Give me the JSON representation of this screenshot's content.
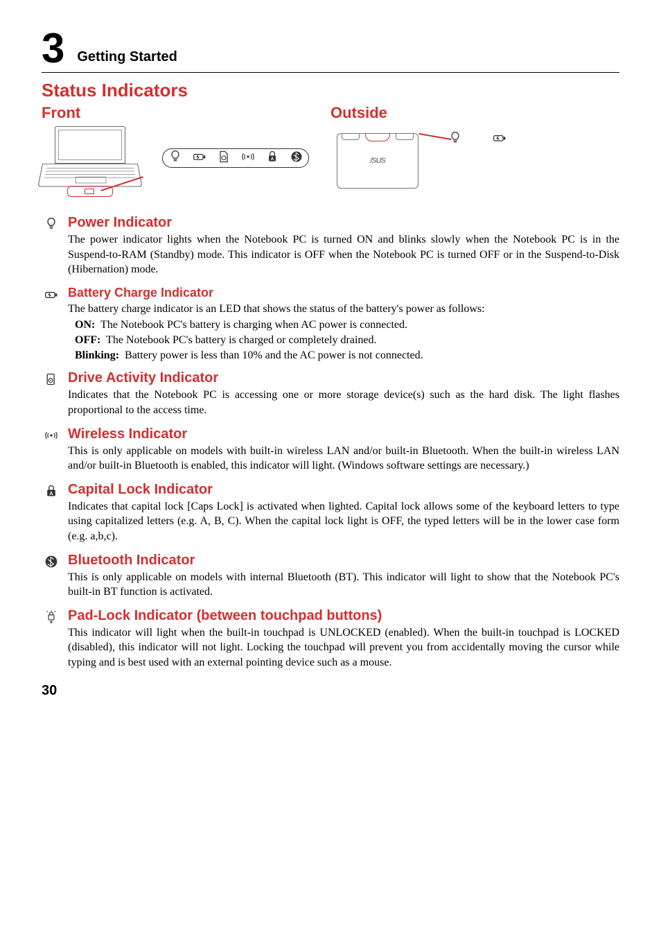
{
  "chapter": {
    "number": "3",
    "title": "Getting Started"
  },
  "section": "Status Indicators",
  "subsections": {
    "front": "Front",
    "outside": "Outside"
  },
  "front_icons": {
    "power": "power-icon",
    "battery": "battery-icon",
    "drive": "drive-icon",
    "wireless": "wireless-icon",
    "caps": "caps-icon",
    "bt": "bt-icon"
  },
  "lid_logo": "/SUS",
  "outside_icons": {
    "power": "power-icon",
    "battery": "battery-icon"
  },
  "indicators": [
    {
      "id": "power",
      "icon": "power-icon",
      "title_size": "big",
      "title": "Power Indicator",
      "body": "The power indicator lights when the Notebook PC is turned ON and blinks slowly when the Notebook PC is in the Suspend-to-RAM (Standby) mode. This indicator is OFF when the Notebook PC is turned OFF or in the Suspend-to-Disk (Hibernation) mode."
    },
    {
      "id": "battery",
      "icon": "battery-icon",
      "title_size": "mid",
      "title": "Battery Charge Indicator",
      "body": "The battery charge indicator is an LED that shows the status of the battery's power as follows:",
      "states": [
        {
          "label": "ON:",
          "text": "The Notebook PC's battery is charging when AC power is connected."
        },
        {
          "label": "OFF:",
          "text": "The Notebook PC's battery is charged or completely drained."
        },
        {
          "label": "Blinking:",
          "text": "Battery power is less than 10% and the AC power is not connected."
        }
      ]
    },
    {
      "id": "drive",
      "icon": "drive-icon",
      "title_size": "big",
      "title": "Drive Activity Indicator",
      "body": "Indicates that the Notebook PC is accessing one or more storage device(s) such as the hard disk. The light flashes proportional to the access time."
    },
    {
      "id": "wireless",
      "icon": "wireless-icon",
      "title_size": "big",
      "title": "Wireless Indicator",
      "body": "This is only applicable on models with built-in wireless LAN and/or built-in Bluetooth. When the built-in wireless LAN and/or built-in Bluetooth is enabled, this indicator will light. (Windows software settings are necessary.)"
    },
    {
      "id": "caps",
      "icon": "caps-icon",
      "title_size": "big",
      "title": "Capital Lock Indicator",
      "body": "Indicates that capital lock [Caps Lock] is activated when lighted. Capital lock allows some of the keyboard letters to type using capitalized letters (e.g. A, B, C). When the capital lock light is OFF, the typed letters will be in the lower case form (e.g. a,b,c)."
    },
    {
      "id": "bluetooth",
      "icon": "bt-icon",
      "title_size": "big",
      "title": "Bluetooth Indicator",
      "body": "This is only applicable on models with internal Bluetooth (BT). This indicator will light to show that the Notebook PC's built-in BT function is activated."
    },
    {
      "id": "padlock",
      "icon": "padlock-icon",
      "title_size": "big",
      "title": "Pad-Lock Indicator (between touchpad buttons)",
      "body": "This indicator will light when the built-in touchpad is UNLOCKED (enabled). When the built-in touchpad is LOCKED (disabled), this indicator will not light. Locking the touchpad will prevent you from accidentally moving the cursor while typing and is best used with an external pointing device such as a mouse."
    }
  ],
  "page_number": "30"
}
